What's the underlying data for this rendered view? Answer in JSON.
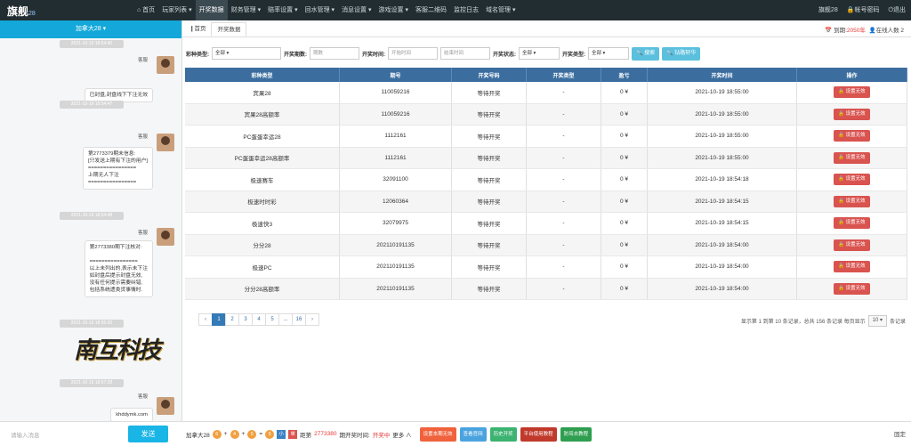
{
  "app": {
    "logo": "旗舰",
    "logo_sub": "28"
  },
  "menu": [
    {
      "label": "⌂ 首页"
    },
    {
      "label": "玩家列表 ▾"
    },
    {
      "label": "开奖数据"
    },
    {
      "label": "财务管理 ▾"
    },
    {
      "label": "赔率设置 ▾"
    },
    {
      "label": "回水管理 ▾"
    },
    {
      "label": "消息设置 ▾"
    },
    {
      "label": "游戏设置 ▾"
    },
    {
      "label": "客服二维码"
    },
    {
      "label": "监控日志"
    },
    {
      "label": "域名管理 ▾"
    }
  ],
  "topright": {
    "user": "旗舰28",
    "password": "帐号密码",
    "logout": "退出"
  },
  "left": {
    "header": "加拿大28 ▾",
    "messages": [
      {
        "time": "2021-10-19 18:54:40",
        "sender": "客服",
        "text": "已封盘,封盘线下下注无效"
      },
      {
        "time": "2021-10-19 18:54:47",
        "sender": "客服",
        "text": "第2773379期未信息:\n[只发送上期有下注的用户]\n================\n上期无人下注\n================"
      },
      {
        "time": "2021-10-19 18:54:48",
        "sender": "客服",
        "text": "第2773380期下注核对:\n\n================\n以上未列出的,表示未下注\n如封盘后提示封盘无效,\n没有任何提示需要纠错,\n包括系统遗类货事情时."
      },
      {
        "time": "2021-10-19 18:55:20",
        "sender": "",
        "text": ""
      },
      {
        "time": "2021-10-19 18:57:28",
        "sender": "客服",
        "text": "khddymk.com"
      }
    ],
    "watermark": "南互科技",
    "input_placeholder": "请输入消息",
    "send": "发送"
  },
  "tabs": [
    {
      "label": "❙首页"
    },
    {
      "label": "开奖数据"
    }
  ],
  "status": {
    "expiry_label": "到期:",
    "expiry_value": "2050年",
    "online": "在线人数 2"
  },
  "filters": {
    "lottery_type_label": "彩种类型:",
    "lottery_type_value": "全部 ▾",
    "issue_label": "开奖期数:",
    "issue_placeholder": "期数",
    "time_label": "开奖时间:",
    "start_placeholder": "开始时间",
    "end_placeholder": "结束时间",
    "status_label": "开奖状态:",
    "status_value": "全部 ▾",
    "type_label": "开奖类型:",
    "type_value": "全部 ▾",
    "search": "🔍 搜索",
    "refresh": "🔍 钻路轩华"
  },
  "table": {
    "headers": [
      "彩种类型",
      "期号",
      "开奖号码",
      "开奖类型",
      "盈亏",
      "开奖时间",
      "操作"
    ],
    "rows": [
      [
        "宾果28",
        "110059216",
        "等待开奖",
        "-",
        "0 ¥",
        "2021-10-19 18:55:00",
        "🔒 设置无效"
      ],
      [
        "宾果28高额率",
        "110059216",
        "等待开奖",
        "-",
        "0 ¥",
        "2021-10-19 18:55:00",
        "🔒 设置无效"
      ],
      [
        "PC蛋蛋幸运28",
        "1112161",
        "等待开奖",
        "-",
        "0 ¥",
        "2021-10-19 18:55:00",
        "🔒 设置无效"
      ],
      [
        "PC蛋蛋幸运28高额率",
        "1112161",
        "等待开奖",
        "-",
        "0 ¥",
        "2021-10-19 18:55:00",
        "🔒 设置无效"
      ],
      [
        "极速赛车",
        "32091100",
        "等待开奖",
        "-",
        "0 ¥",
        "2021-10-19 18:54:18",
        "🔒 设置无效"
      ],
      [
        "极速时时彩",
        "12060364",
        "等待开奖",
        "-",
        "0 ¥",
        "2021-10-19 18:54:15",
        "🔒 设置无效"
      ],
      [
        "极速快3",
        "32079975",
        "等待开奖",
        "-",
        "0 ¥",
        "2021-10-19 18:54:15",
        "🔒 设置无效"
      ],
      [
        "分分28",
        "202110191135",
        "等待开奖",
        "-",
        "0 ¥",
        "2021-10-19 18:54:00",
        "🔒 设置无效"
      ],
      [
        "极速PC",
        "202110191135",
        "等待开奖",
        "-",
        "0 ¥",
        "2021-10-19 18:54:00",
        "🔒 设置无效"
      ],
      [
        "分分28高额率",
        "202110191135",
        "等待开奖",
        "-",
        "0 ¥",
        "2021-10-19 18:54:00",
        "🔒 设置无效"
      ]
    ]
  },
  "pager": {
    "pages": [
      "‹",
      "1",
      "2",
      "3",
      "4",
      "5",
      "...",
      "16",
      "›"
    ],
    "info": "显示第 1 到第 10 条记录，总共 156 条记录  每页显示",
    "size": "10 ▾",
    "suffix": "条记录"
  },
  "bottom": {
    "game": "加拿大28",
    "balls": [
      "6",
      "4",
      "5",
      "5"
    ],
    "ops": [
      "+",
      "+",
      "="
    ],
    "tag_small": "小",
    "tag_double": "单",
    "issue_prefix": "距第",
    "issue": "2773380",
    "issue_suffix": "期开奖时间:",
    "state": "开奖中",
    "more": "更多 ∧",
    "buttons": [
      {
        "label": "设置本期无效",
        "color": "#f0623c"
      },
      {
        "label": "查看官网",
        "color": "#4aa3df"
      },
      {
        "label": "历史开奖",
        "color": "#3cb371"
      },
      {
        "label": "平台使用教程",
        "color": "#c0392b"
      },
      {
        "label": "防骂去教程",
        "color": "#2e9e4f"
      }
    ],
    "fix": "固定"
  }
}
